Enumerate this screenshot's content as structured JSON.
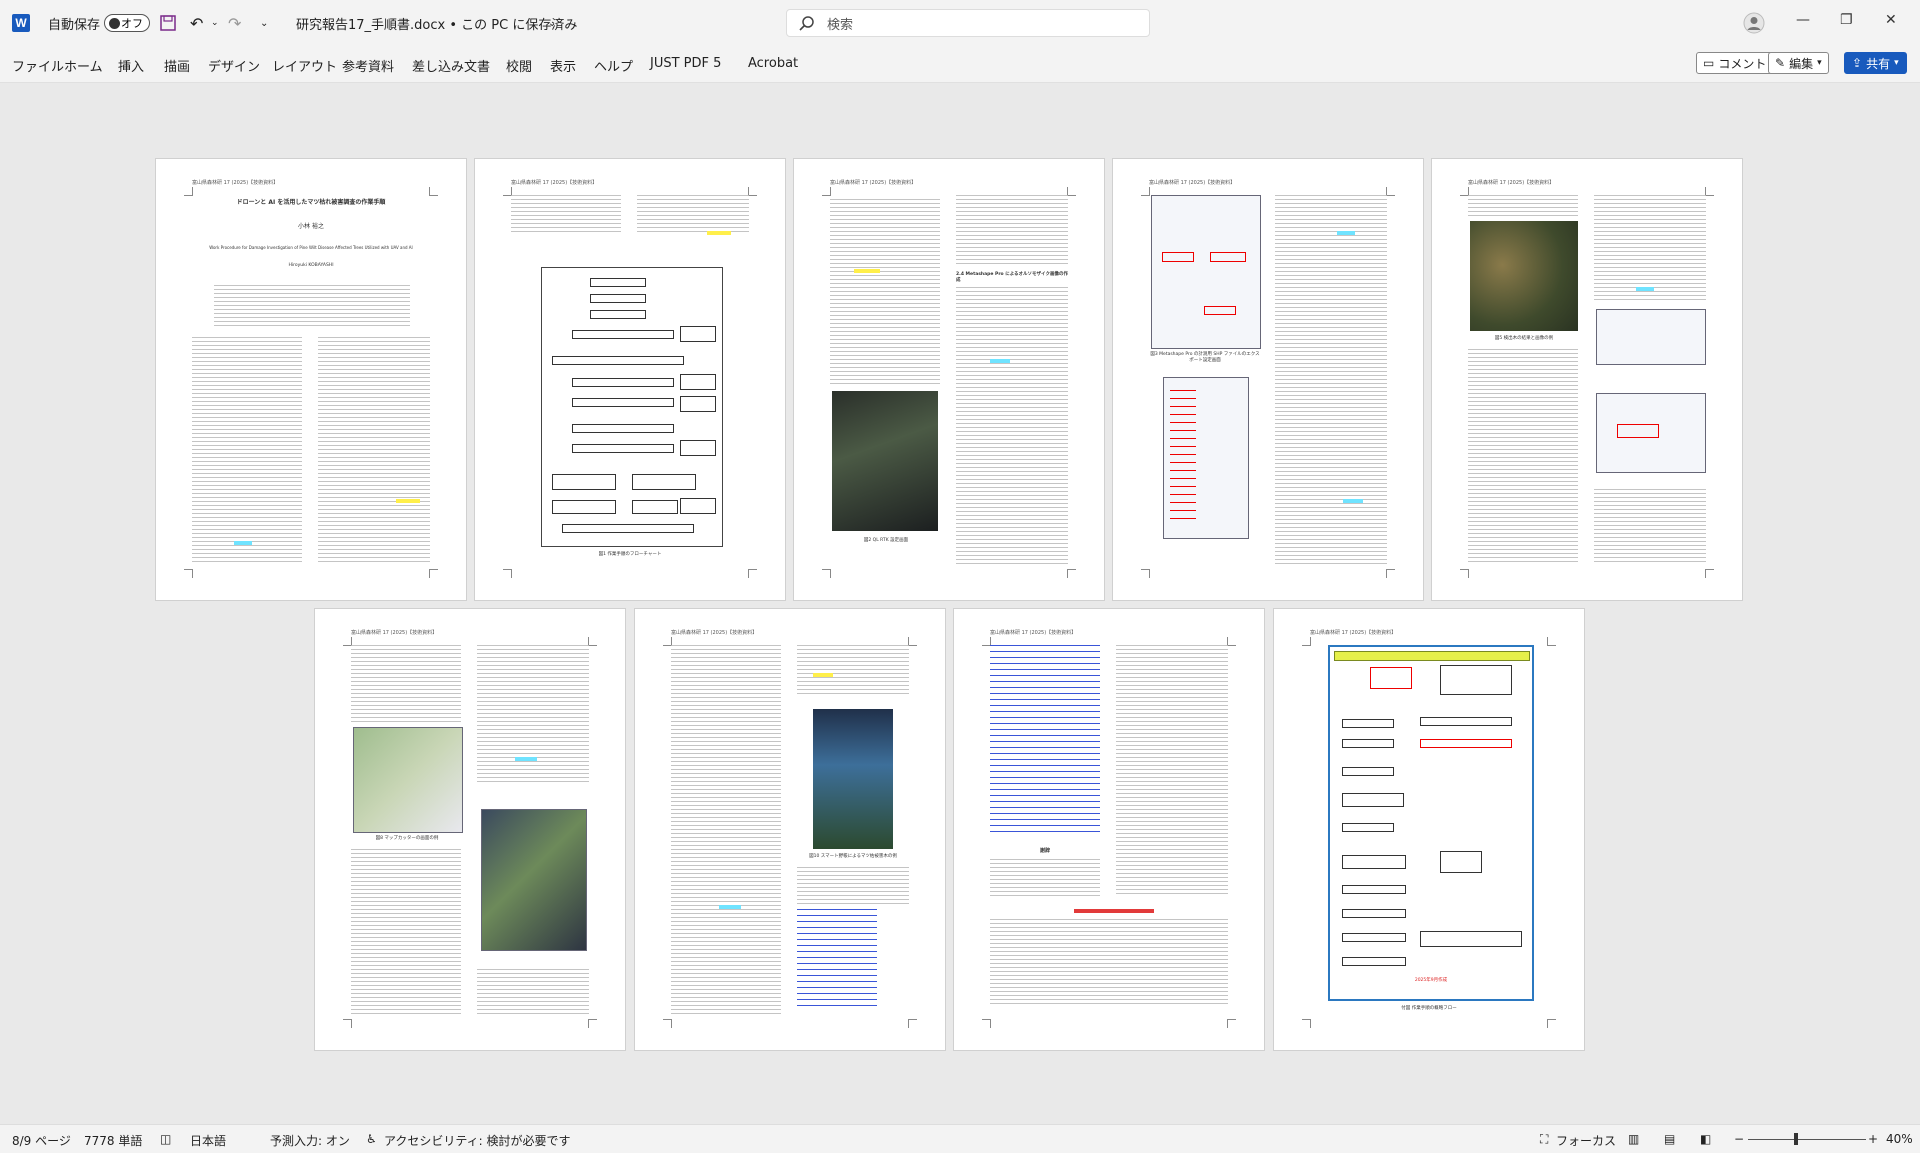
{
  "titlebar": {
    "autosave_label": "自動保存",
    "autosave_state": "オフ",
    "document_title": "研究報告17_手順書.docx • この PC に保存済み",
    "search_placeholder": "検索"
  },
  "menubar": {
    "tabs": [
      "ファイル",
      "ホーム",
      "挿入",
      "描画",
      "デザイン",
      "レイアウト",
      "参考資料",
      "差し込み文書",
      "校閲",
      "表示",
      "ヘルプ",
      "JUST PDF 5",
      "Acrobat"
    ],
    "comment_label": "コメント",
    "edit_label": "編集",
    "share_label": "共有"
  },
  "pages": {
    "header_text": "富山県森林研 17 (2025)【技術資料】",
    "p1_title": "ドローンと AI を活用したマツ枯れ被害調査の作業手順",
    "p1_author": "小林 裕之",
    "p1_en_title": "Work Procedure for Damage Investigation of Pine Wilt Disease Affected Trees Utilized with UAV and AI",
    "p1_en_author": "Hiroyuki KOBAYASHI",
    "p2_caption": "図1 作業手順のフローチャート",
    "p3_caption": "図2 QL RTK 設定画面",
    "p3_heading": "2.4 Metashape Pro によるオルソモザイク画像の作成",
    "p4_caption": "図3 Metashape Pro の計測用 SHP ファイルのエクスポート設定画面",
    "p5_caption": "図5 検出木の結果と画像の例",
    "p6_caption": "図8 マップカッターの画面の例",
    "p7_caption": "図10 スマート野帳によるマツ枯被害木の例",
    "p8_heading": "謝辞",
    "p9_caption": "付図 作業手順の概略フロー",
    "p9_footer": "2025年9月作成"
  },
  "statusbar": {
    "page": "8/9 ページ",
    "words": "7778 単語",
    "language": "日本語",
    "predict": "予測入力: オン",
    "accessibility": "アクセシビリティ: 検討が必要です",
    "focus": "フォーカス",
    "zoom": "40%"
  }
}
